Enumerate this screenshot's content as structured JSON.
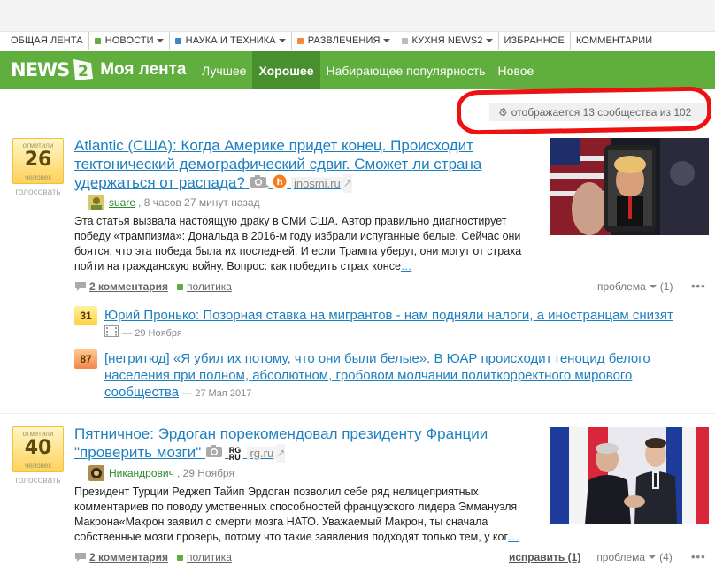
{
  "categories": [
    {
      "label": "ОБЩАЯ ЛЕНТА",
      "color": "",
      "dropdown": false
    },
    {
      "label": "НОВОСТИ",
      "color": "#5fae3e",
      "dropdown": true
    },
    {
      "label": "НАУКА И ТЕХНИКА",
      "color": "#3b88c9",
      "dropdown": true
    },
    {
      "label": "РАЗВЛЕЧЕНИЯ",
      "color": "#f08a3c",
      "dropdown": true
    },
    {
      "label": "КУХНЯ NEWS2",
      "color": "#bbbbbb",
      "dropdown": true
    },
    {
      "label": "ИЗБРАННОЕ",
      "color": "",
      "dropdown": false
    },
    {
      "label": "КОММЕНТАРИИ",
      "color": "",
      "dropdown": false
    }
  ],
  "header": {
    "logo_text": "NEWS",
    "title": "Моя лента",
    "tabs": [
      "Лучшее",
      "Хорошее",
      "Набирающее популярность",
      "Новое"
    ],
    "active_tab": 1
  },
  "stats": {
    "text": "отображается 13 сообщества из 102"
  },
  "posts": [
    {
      "votes_label": "отметили",
      "votes": "26",
      "votes_unit": "человек",
      "vote_caption": "голосовать",
      "title": "Atlantic (США): Когда Америке придет конец. Происходит тектонический демографический сдвиг. Сможет ли страна удержаться от распада?",
      "source": "inosmi.ru",
      "author": "suare",
      "time": ", 8 часов 27 минут назад",
      "excerpt": "Эта статья вызвала настоящую драку в СМИ США. Автор правильно диагностирует победу «трампизма»: Дональда в 2016-м году избрали испуганные белые. Сейчас они боятся, что эта победа была их последней. И если Трампа уберут, они могут от страха пойти на гражданскую войну. Вопрос: как победить страх консе",
      "more": "…",
      "comments": "2 комментария",
      "tag": "политика",
      "problem": "проблема",
      "problem_count": "(1)",
      "related": [
        {
          "score": "31",
          "title": "Юрий Пронько: Позорная ставка на мигрантов - нам подняли налоги, а иностранцам снизят",
          "date": "— 29 Ноября"
        },
        {
          "score": "87",
          "title": "[негритюд] «Я убил их потому, что они были белые». В ЮАР происходит геноцид белого населения при полном, абсолютном, гробовом молчании политкорректного мирового сообщества",
          "date": "— 27 Мая 2017"
        }
      ]
    },
    {
      "votes_label": "отметили",
      "votes": "40",
      "votes_unit": "человек",
      "vote_caption": "голосовать",
      "title": "Пятничное: Эрдоган порекомендовал президенту Франции \"проверить мозги\"",
      "source_badge": "RG RU",
      "source": "rg.ru",
      "author": "Никандрович",
      "time": ", 29 Ноября",
      "excerpt": "Президент Турции Реджеп Тайип Эрдоган позволил себе ряд нелицеприятных комментариев по поводу умственных способностей французского лидера Эммануэля Макрона«Макрон заявил о смерти мозга НАТО. Уважаемый Макрон, ты сначала собственные мозги проверь, потому что такие заявления подходят только тем, у ког",
      "more": "…",
      "comments": "2 комментария",
      "tag": "политика",
      "fix": "исправить (1)",
      "problem": "проблема",
      "problem_count": "(4)"
    }
  ]
}
